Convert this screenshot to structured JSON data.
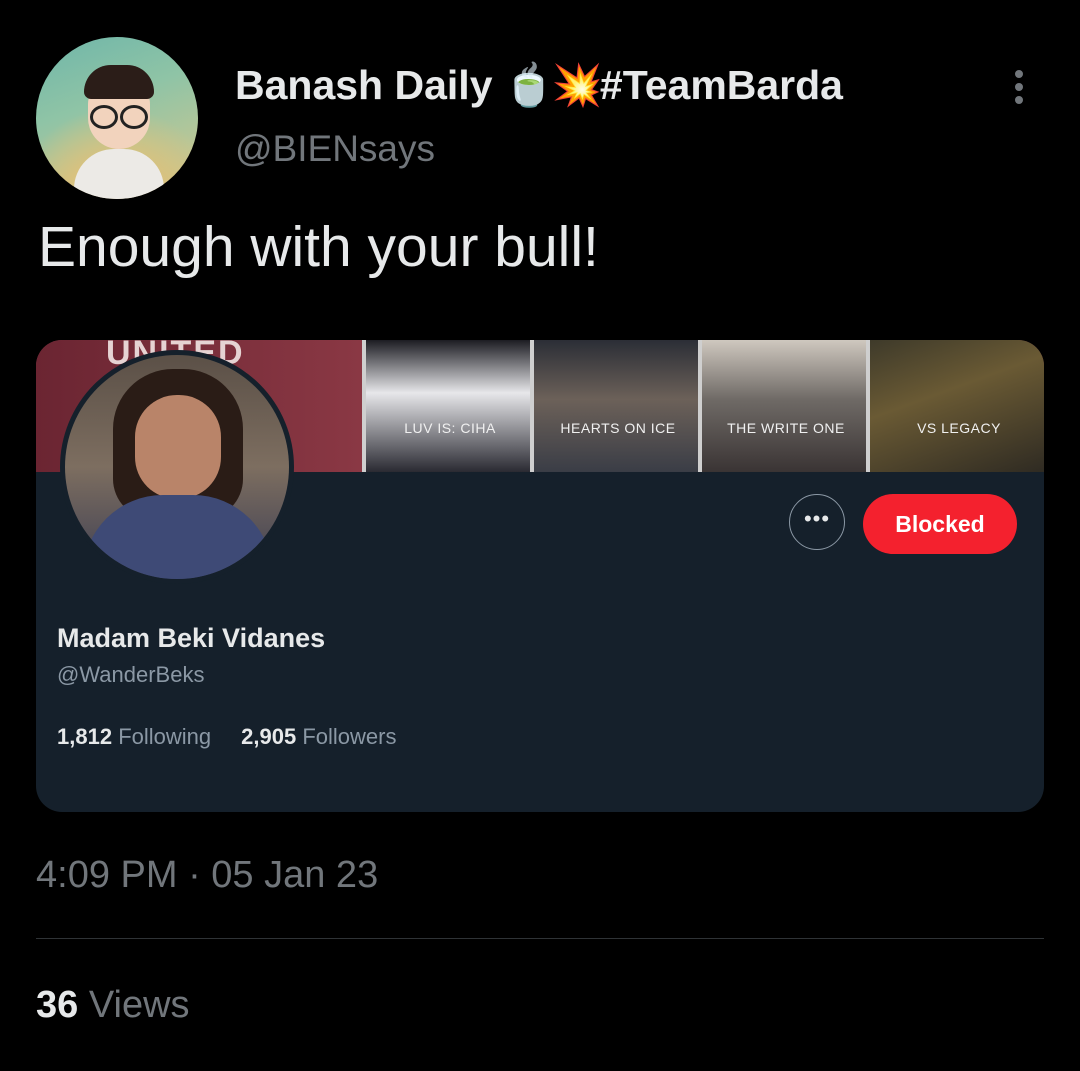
{
  "author": {
    "display_name": "Banash Daily",
    "emoji_1": "🍵",
    "emoji_2": "💥",
    "display_suffix": "#TeamBarda",
    "handle": "@BIENsays"
  },
  "tweet": {
    "text": "Enough with your bull!",
    "timestamp": "4:09 PM · 05 Jan 23",
    "views_count": "36",
    "views_label": "Views"
  },
  "profile_card": {
    "banner_partial_text": "UNITED",
    "banner_tiles": [
      "LUV IS: CIHA",
      "HEARTS ON ICE",
      "THE WRITE ONE",
      "VS LEGACY"
    ],
    "more_button_label": "•••",
    "blocked_button_label": "Blocked",
    "name": "Madam Beki Vidanes",
    "handle": "@WanderBeks",
    "following_count": "1,812",
    "following_label": "Following",
    "followers_count": "2,905",
    "followers_label": "Followers"
  },
  "colors": {
    "background": "#000000",
    "card_background": "#15202b",
    "blocked_red": "#f4212e",
    "secondary_text": "#71767b"
  },
  "icons": {
    "more": "more-vertical-icon",
    "card_more": "more-horizontal-icon"
  }
}
